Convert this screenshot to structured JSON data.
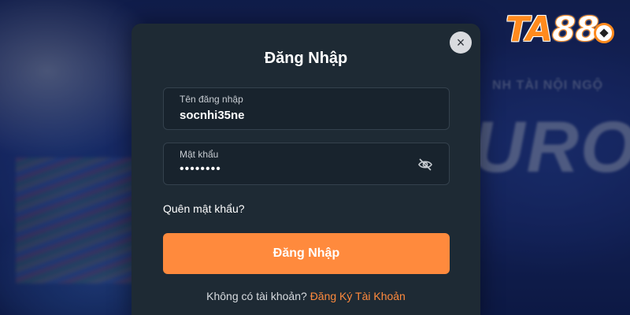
{
  "brand": {
    "logo_ta": "TA",
    "logo_num": "88",
    "accent": "#ff8a3d"
  },
  "background": {
    "big_text": "URO",
    "small_text": "NH TÀI NỘI NGỘ"
  },
  "modal": {
    "title": "Đăng Nhập",
    "close_icon": "×",
    "username": {
      "label": "Tên đăng nhập",
      "value": "socnhi35ne"
    },
    "password": {
      "label": "Mật khẩu",
      "value": "••••••••",
      "toggle_icon": "eye-slash-icon"
    },
    "forgot_label": "Quên mật khẩu?",
    "submit_label": "Đăng Nhập",
    "no_account_text": "Không có tài khoản?",
    "register_label": "Đăng Ký Tài Khoản"
  }
}
